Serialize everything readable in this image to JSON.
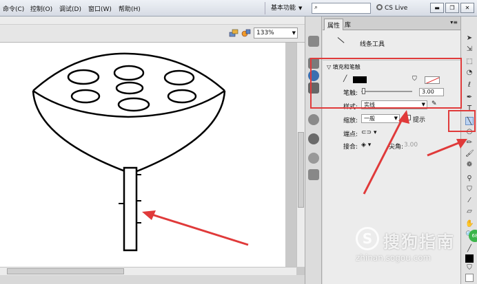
{
  "menu": {
    "items": [
      "命令(C)",
      "控制(O)",
      "调试(D)",
      "窗口(W)",
      "帮助(H)"
    ]
  },
  "workspace": {
    "label": "基本功能"
  },
  "search": {
    "icon": "search-icon",
    "value": ""
  },
  "cs_live": {
    "label": "CS Live"
  },
  "window_controls": {
    "minimize": "▬",
    "restore": "❐",
    "close": "✕"
  },
  "zoom": {
    "value": "133%"
  },
  "panel": {
    "tabs": [
      "属性",
      "库"
    ],
    "tool_name": "线条工具",
    "section_title": "填充和笔触",
    "stroke_label": "笔触:",
    "stroke_value": "3.00",
    "style_label": "样式:",
    "style_value": "实线",
    "scale_label": "缩放:",
    "scale_value": "一般",
    "hint_label": "提示",
    "cap_label": "端点:",
    "join_label": "接合:",
    "miter_label": "尖角:",
    "miter_value": "3.00"
  },
  "colors": {
    "stroke": "#000000",
    "annotation": "#e03a3a"
  },
  "watermark": {
    "logo": "S",
    "text": "搜狗指南",
    "url": "zhinan.sogou.com"
  },
  "badge": {
    "text": "68"
  }
}
